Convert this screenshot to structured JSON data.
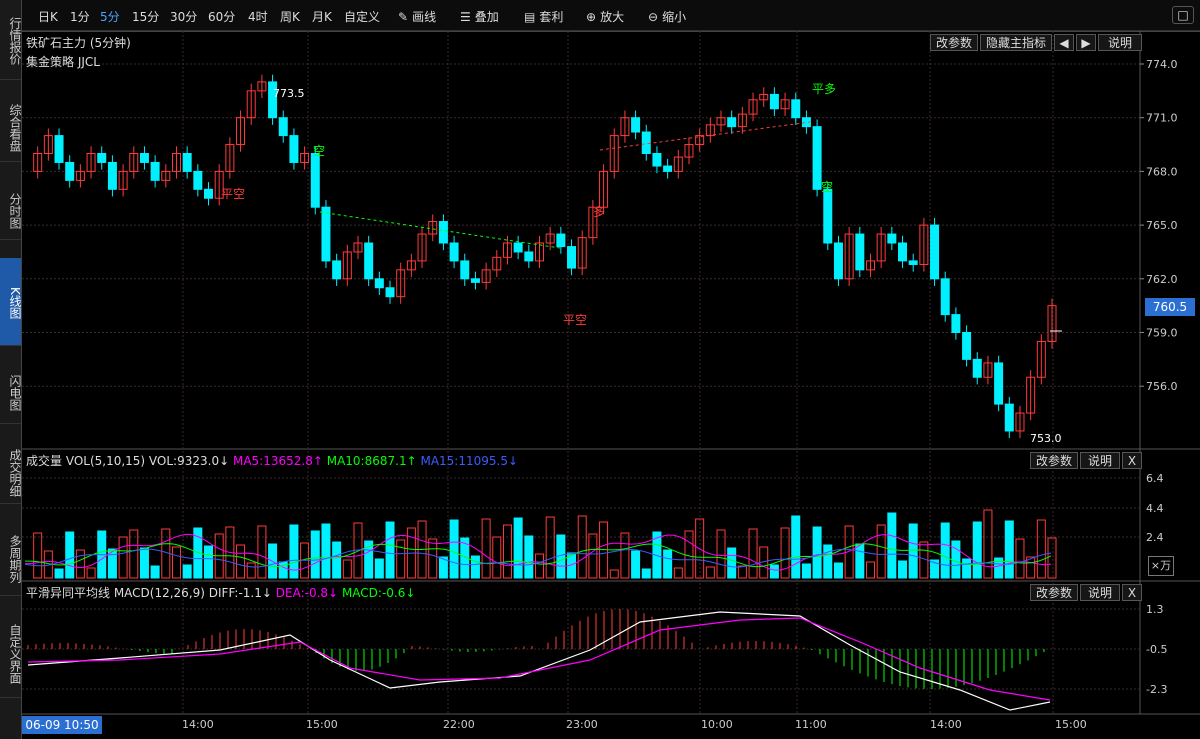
{
  "sidebar": {
    "tabs": [
      {
        "label": "行情报价",
        "active": false
      },
      {
        "label": "综合看盘",
        "active": false
      },
      {
        "label": "分时图",
        "active": false
      },
      {
        "label": "K线图",
        "active": true
      },
      {
        "label": "闪电图",
        "active": false
      },
      {
        "label": "成交明细",
        "active": false
      },
      {
        "label": "多周期列",
        "active": false
      },
      {
        "label": "自定义界面",
        "active": false
      }
    ]
  },
  "toolbar": {
    "periods": [
      "日K",
      "1分",
      "5分",
      "15分",
      "30分",
      "60分",
      "4时",
      "周K",
      "月K",
      "自定义"
    ],
    "active_period": "5分",
    "tools": [
      {
        "label": "画线",
        "icon": "pencil-icon"
      },
      {
        "label": "叠加",
        "icon": "stack-icon"
      },
      {
        "label": "套利",
        "icon": "arbitrage-icon"
      },
      {
        "label": "放大",
        "icon": "zoom-in-icon"
      },
      {
        "label": "缩小",
        "icon": "zoom-out-icon"
      }
    ]
  },
  "main_panel": {
    "title": "铁矿石主力 (5分钟)",
    "strategy": "集金策略 JJCL",
    "buttons": {
      "params": "改参数",
      "hide_indicator": "隐藏主指标",
      "help": "说明"
    },
    "price_axis": [
      "774.0",
      "771.0",
      "768.0",
      "765.0",
      "762.0",
      "759.0",
      "756.0"
    ],
    "current_price": "760.5",
    "high_label": "773.5",
    "low_label": "753.0",
    "signals": [
      "平空",
      "空",
      "多",
      "平空",
      "平多",
      "空"
    ]
  },
  "volume_panel": {
    "label": "成交量 VOL(5,10,15) VOL:9323.0↓",
    "ma5": "MA5:13652.8↑",
    "ma10": "MA10:8687.1↑",
    "ma15": "MA15:11095.5↓",
    "axis": [
      "6.4",
      "4.4",
      "2.4"
    ],
    "unit": "×万",
    "buttons": {
      "params": "改参数",
      "help": "说明",
      "close": "X"
    }
  },
  "macd_panel": {
    "label": "平滑异同平均线 MACD(12,26,9) DIFF:-1.1↓",
    "dea": "DEA:-0.8↓",
    "macd": "MACD:-0.6↓",
    "axis": [
      "1.3",
      "-0.5",
      "-2.3"
    ],
    "buttons": {
      "params": "改参数",
      "help": "说明",
      "close": "X"
    }
  },
  "time_axis": {
    "cursor_label": "06-09 10:50",
    "labels": [
      "14:00",
      "15:00",
      "22:00",
      "23:00",
      "10:00",
      "11:00",
      "14:00",
      "15:00"
    ]
  },
  "colors": {
    "up": "#ff3b3b",
    "down": "#00f0ff",
    "ma5": "#ff00ff",
    "ma10": "#00ff00",
    "ma15": "#3a5cff",
    "accent": "#2a6fd1"
  }
}
